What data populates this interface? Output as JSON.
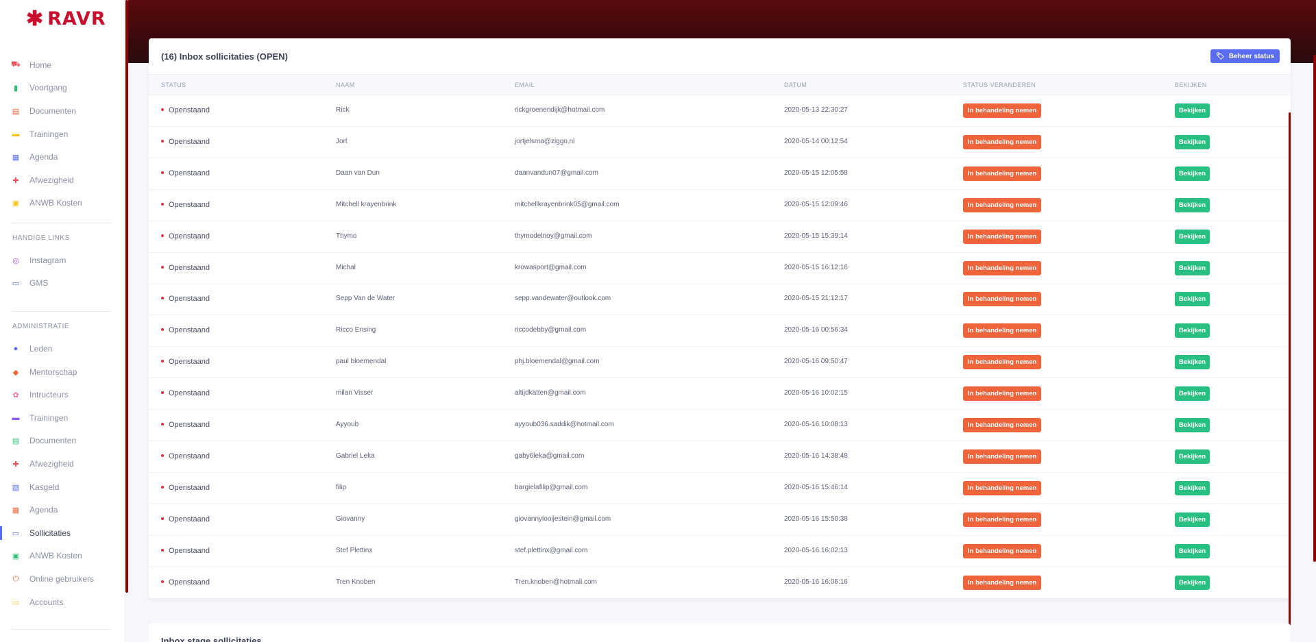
{
  "brand": {
    "name": "RAVR",
    "mark": "✱"
  },
  "sidebar": {
    "main_items": [
      {
        "label": "Home",
        "icon": "truck-icon",
        "glyph": "⛟",
        "color": "#e8505b"
      },
      {
        "label": "Voortgang",
        "icon": "chart-bar-icon",
        "glyph": "▮",
        "color": "#2cc070"
      },
      {
        "label": "Documenten",
        "icon": "document-icon",
        "glyph": "▤",
        "color": "#f0643c"
      },
      {
        "label": "Trainingen",
        "icon": "briefcase-icon",
        "glyph": "▬",
        "color": "#f5c518"
      },
      {
        "label": "Agenda",
        "icon": "calendar-icon",
        "glyph": "▦",
        "color": "#5a6cf0"
      },
      {
        "label": "Afwezigheid",
        "icon": "pills-icon",
        "glyph": "✚",
        "color": "#e8505b"
      },
      {
        "label": "ANWB Kosten",
        "icon": "bus-icon",
        "glyph": "▣",
        "color": "#f5c518"
      }
    ],
    "links_heading": "HANDIGE LINKS",
    "links_items": [
      {
        "label": "Instagram",
        "icon": "instagram-icon",
        "glyph": "◎",
        "color": "#b45bd6"
      },
      {
        "label": "GMS",
        "icon": "card-icon",
        "glyph": "▭",
        "color": "#5a6cf0"
      }
    ],
    "admin_heading": "ADMINISTRATIE",
    "admin_items": [
      {
        "label": "Leden",
        "icon": "user-icon",
        "glyph": "●",
        "color": "#5a6cf0"
      },
      {
        "label": "Mentorschap",
        "icon": "box-icon",
        "glyph": "◆",
        "color": "#f0643c"
      },
      {
        "label": "Intructeurs",
        "icon": "badge-icon",
        "glyph": "✿",
        "color": "#f07090"
      },
      {
        "label": "Trainingen",
        "icon": "briefcase-icon",
        "glyph": "▬",
        "color": "#8a5cf0"
      },
      {
        "label": "Documenten",
        "icon": "document-icon",
        "glyph": "▤",
        "color": "#2cc070"
      },
      {
        "label": "Afwezigheid",
        "icon": "pills-icon",
        "glyph": "✚",
        "color": "#e8505b"
      },
      {
        "label": "Kasgeld",
        "icon": "calculator-icon",
        "glyph": "▧",
        "color": "#5a6cf0"
      },
      {
        "label": "Agenda",
        "icon": "calendar-icon",
        "glyph": "▦",
        "color": "#f0643c"
      },
      {
        "label": "Sollicitaties",
        "icon": "laptop-icon",
        "glyph": "▭",
        "color": "#5a6cf0",
        "active": true
      },
      {
        "label": "ANWB Kosten",
        "icon": "bus-icon",
        "glyph": "▣",
        "color": "#2cc070"
      },
      {
        "label": "Online gebruikers",
        "icon": "power-icon",
        "glyph": "⏻",
        "color": "#f0643c"
      },
      {
        "label": "Accounts",
        "icon": "laptop-icon",
        "glyph": "▭",
        "color": "#f5c518"
      }
    ]
  },
  "main": {
    "title": "(16) Inbox sollicitaties (OPEN)",
    "beheer_label": "Beheer status",
    "columns": [
      "STATUS",
      "NAAM",
      "EMAIL",
      "DATUM",
      "STATUS VERANDEREN",
      "BEKIJKEN"
    ],
    "action_label": "In behandeling nemen",
    "view_label": "Bekijken",
    "rows": [
      {
        "status": "Openstaand",
        "naam": "Rick",
        "email": "rickgroenendijk@hotmail.com",
        "datum": "2020-05-13 22:30:27"
      },
      {
        "status": "Openstaand",
        "naam": "Jort",
        "email": "jortjelsma@ziggo.nl",
        "datum": "2020-05-14 00:12:54"
      },
      {
        "status": "Openstaand",
        "naam": "Daan van Dun",
        "email": "daanvandun07@gmail.com",
        "datum": "2020-05-15 12:05:58"
      },
      {
        "status": "Openstaand",
        "naam": "Mitchell krayenbrink",
        "email": "mitchellkrayenbrink05@gmail.com",
        "datum": "2020-05-15 12:09:46"
      },
      {
        "status": "Openstaand",
        "naam": "Thymo",
        "email": "thymodelnoy@gmail.com",
        "datum": "2020-05-15 15:39:14"
      },
      {
        "status": "Openstaand",
        "naam": "Michal",
        "email": "krowasport@gmail.com",
        "datum": "2020-05-15 16:12:16"
      },
      {
        "status": "Openstaand",
        "naam": "Sepp Van de Water",
        "email": "sepp.vandewater@outlook.com",
        "datum": "2020-05-15 21:12:17"
      },
      {
        "status": "Openstaand",
        "naam": "Ricco Ensing",
        "email": "riccodebby@gmail.com",
        "datum": "2020-05-16 00:56:34"
      },
      {
        "status": "Openstaand",
        "naam": "paul bloemendal",
        "email": "phj.bloemendal@gmail.com",
        "datum": "2020-05-16 09:50:47"
      },
      {
        "status": "Openstaand",
        "naam": "milan Visser",
        "email": "altijdkatten@gmail.com",
        "datum": "2020-05-16 10:02:15"
      },
      {
        "status": "Openstaand",
        "naam": "Ayyoub",
        "email": "ayyoub036.saddik@hotmail.com",
        "datum": "2020-05-16 10:08:13"
      },
      {
        "status": "Openstaand",
        "naam": "Gabriel Leka",
        "email": "gaby6leka@gmail.com",
        "datum": "2020-05-16 14:38:48"
      },
      {
        "status": "Openstaand",
        "naam": "filip",
        "email": "bargielafilip@gmail.com",
        "datum": "2020-05-16 15:46:14"
      },
      {
        "status": "Openstaand",
        "naam": "Giovanny",
        "email": "giovannylooijestein@gmail.com",
        "datum": "2020-05-16 15:50:38"
      },
      {
        "status": "Openstaand",
        "naam": "Stef Plettinx",
        "email": "stef.plettinx@gmail.com",
        "datum": "2020-05-16 16:02:13"
      },
      {
        "status": "Openstaand",
        "naam": "Tren Knoben",
        "email": "Tren.knoben@hotmail.com",
        "datum": "2020-05-16 16:06:16"
      }
    ]
  },
  "second_card": {
    "title": "Inbox stage sollicitaties"
  }
}
